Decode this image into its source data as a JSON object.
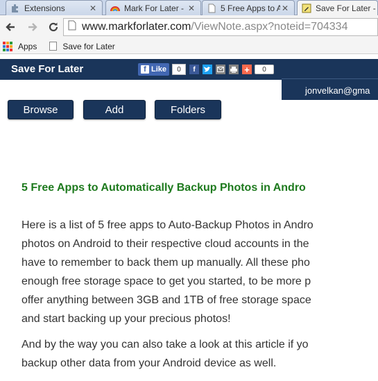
{
  "browser": {
    "tabs": [
      {
        "title": "Extensions",
        "icon": "puzzle-icon",
        "active": false
      },
      {
        "title": "Mark For Later -",
        "icon": "rainbow-icon",
        "active": false
      },
      {
        "title": "5 Free Apps to A",
        "icon": "page-icon",
        "active": false
      },
      {
        "title": "Save For Later -",
        "icon": "note-icon",
        "active": true
      }
    ],
    "close_glyph": "✕",
    "url_host": "www.markforlater.com",
    "url_path": "/ViewNote.aspx?noteid=704334",
    "bookmarks": [
      {
        "label": "Apps",
        "icon": "apps-grid-icon"
      },
      {
        "label": "Save for Later",
        "icon": "page-icon"
      }
    ]
  },
  "site": {
    "title": "Save For Later",
    "fb_like_label": "Like",
    "fb_like_count": "0",
    "share_count": "0",
    "share_icons": [
      "facebook-icon",
      "twitter-icon",
      "email-icon",
      "print-icon",
      "plus-share-icon"
    ],
    "user_email": "jonvelkan@gma",
    "nav_buttons": [
      "Browse",
      "Add",
      "Folders"
    ],
    "accent_color": "#1a355a",
    "title_color": "#1e7a1e"
  },
  "article": {
    "title": "5 Free Apps to Automatically Backup Photos in Andro",
    "paragraph1": [
      "Here is a list of 5 free apps to Auto-Backup Photos in Andro",
      "photos on Android to their respective cloud accounts in the",
      "have to remember to back them up manually. All these pho",
      "enough free storage space to get you started, to be more p",
      "offer anything between 3GB and 1TB of free storage space",
      "and start backing up your precious photos!"
    ],
    "paragraph2": [
      "And by the way you can also take a look at this article if yo",
      "backup other data from your Android device as well."
    ]
  }
}
